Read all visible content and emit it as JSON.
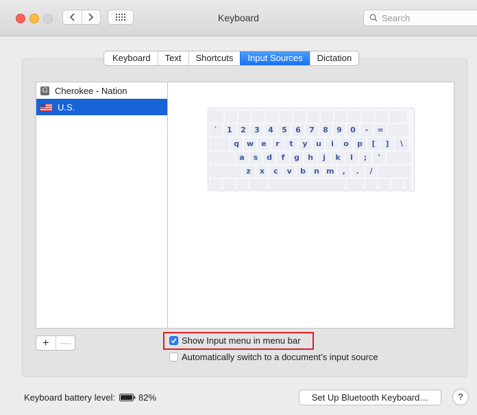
{
  "window": {
    "title": "Keyboard",
    "search_placeholder": "Search"
  },
  "tabs": [
    {
      "label": "Keyboard",
      "active": false
    },
    {
      "label": "Text",
      "active": false
    },
    {
      "label": "Shortcuts",
      "active": false
    },
    {
      "label": "Input Sources",
      "active": true
    },
    {
      "label": "Dictation",
      "active": false
    }
  ],
  "input_sources": [
    {
      "label": "Cherokee - Nation",
      "icon": "cherokee-g-icon",
      "selected": false
    },
    {
      "label": "U.S.",
      "icon": "us-flag-icon",
      "selected": true
    }
  ],
  "keyboard_rows": [
    [
      "`",
      "1",
      "2",
      "3",
      "4",
      "5",
      "6",
      "7",
      "8",
      "9",
      "0",
      "-",
      "="
    ],
    [
      "q",
      "w",
      "e",
      "r",
      "t",
      "y",
      "u",
      "i",
      "o",
      "p",
      "[",
      "]",
      "\\"
    ],
    [
      "a",
      "s",
      "d",
      "f",
      "g",
      "h",
      "j",
      "k",
      "l",
      ";",
      "'"
    ],
    [
      "z",
      "x",
      "c",
      "v",
      "b",
      "n",
      "m",
      ",",
      ".",
      "/"
    ]
  ],
  "list_controls": {
    "add": "+",
    "remove": "—"
  },
  "options": {
    "show_input_menu": {
      "label": "Show Input menu in menu bar",
      "checked": true
    },
    "auto_switch": {
      "label": "Automatically switch to a document’s input source",
      "checked": false
    }
  },
  "footer": {
    "battery_label": "Keyboard battery level:",
    "battery_percent": "82%",
    "bluetooth_button": "Set Up Bluetooth Keyboard…",
    "help": "?"
  },
  "colors": {
    "accent": "#1a72f0",
    "selection": "#1763d8",
    "highlight_box": "#e01b24"
  }
}
